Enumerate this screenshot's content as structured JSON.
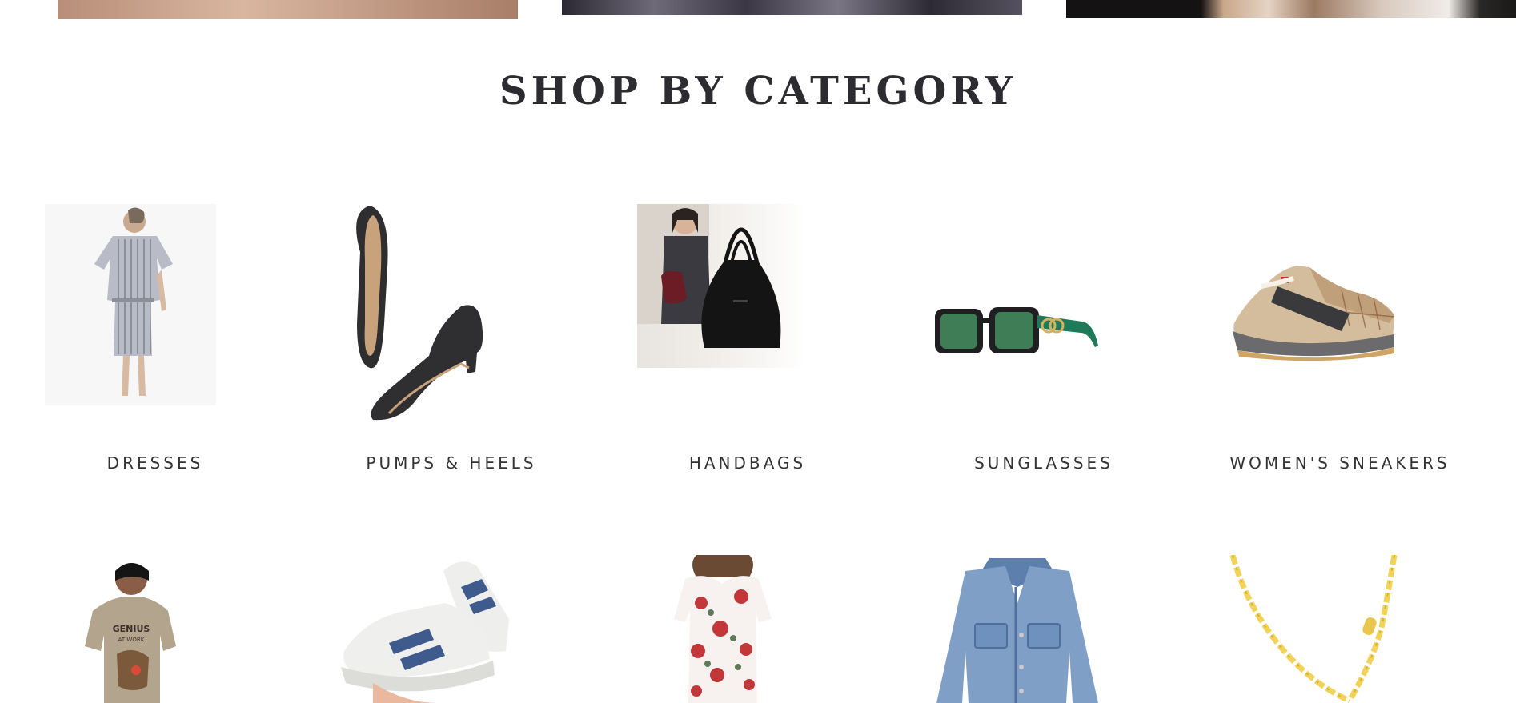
{
  "section_title": "SHOP BY CATEGORY",
  "categories_row1": [
    {
      "label": "DRESSES",
      "icon": "dress-image"
    },
    {
      "label": "PUMPS & HEELS",
      "icon": "heels-image"
    },
    {
      "label": "HANDBAGS",
      "icon": "handbag-image"
    },
    {
      "label": "SUNGLASSES",
      "icon": "sunglasses-image"
    },
    {
      "label": "WOMEN'S SNEAKERS",
      "icon": "sneaker-image"
    }
  ],
  "categories_row2": [
    {
      "icon": "mens-tshirt-image",
      "printed_text": "GENIUS AT WORK"
    },
    {
      "icon": "white-sneakers-image"
    },
    {
      "icon": "floral-blouse-image"
    },
    {
      "icon": "denim-jacket-image"
    },
    {
      "icon": "gold-chain-image"
    }
  ]
}
